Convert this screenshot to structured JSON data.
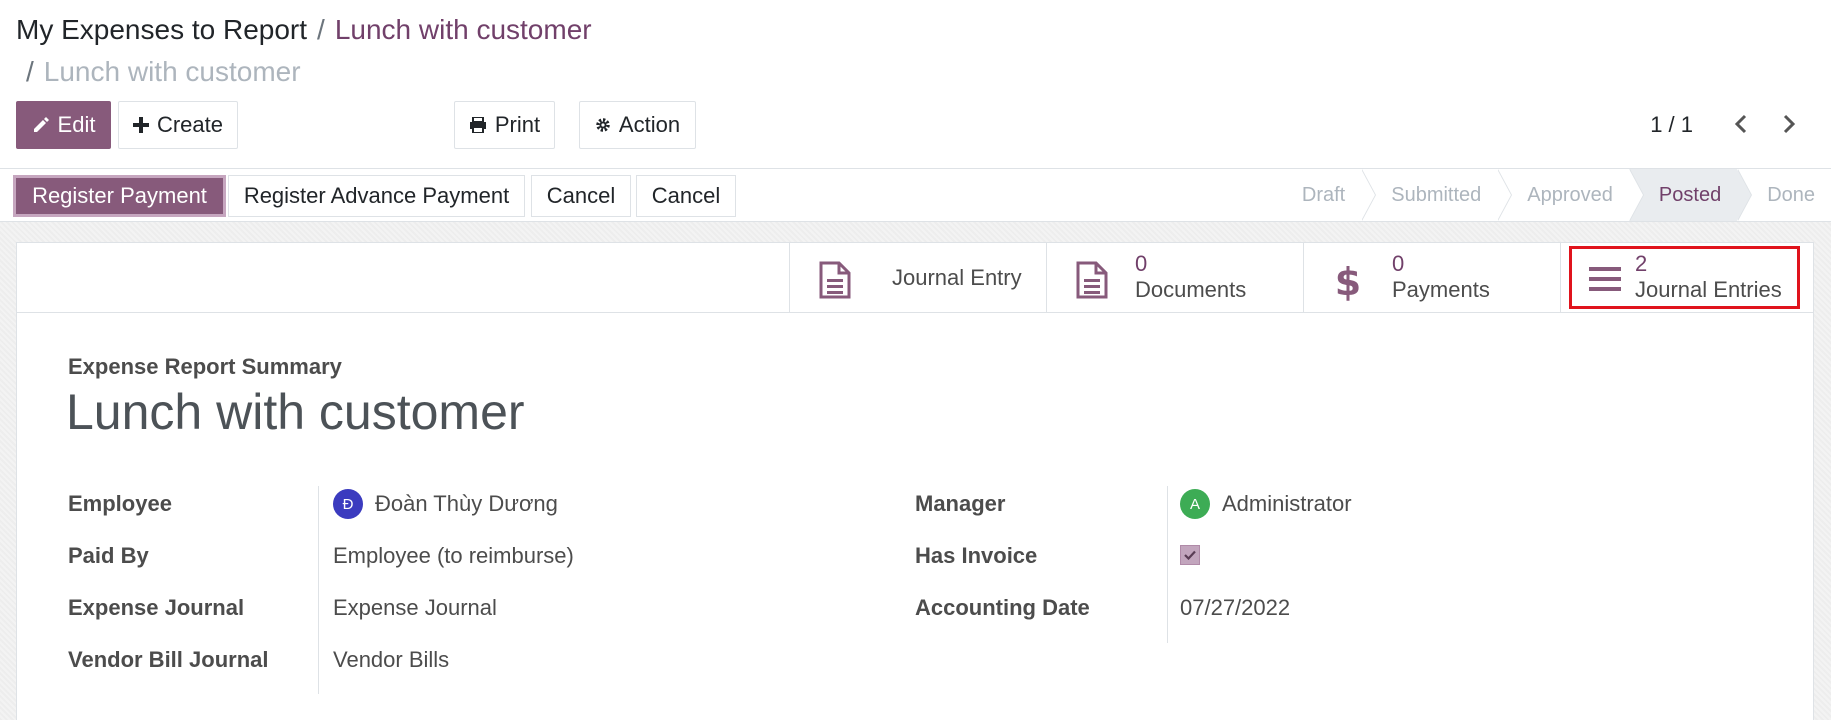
{
  "breadcrumb": {
    "root": "My Expenses to Report",
    "separator": "/",
    "parent": "Lunch with customer",
    "current": "Lunch with customer"
  },
  "toolbar": {
    "edit_label": "Edit",
    "create_label": "Create",
    "print_label": "Print",
    "action_label": "Action"
  },
  "pager": {
    "value": "1 / 1"
  },
  "statusbar": {
    "buttons": [
      "Register Payment",
      "Register Advance Payment",
      "Cancel",
      "Cancel"
    ],
    "stages": [
      "Draft",
      "Submitted",
      "Approved",
      "Posted",
      "Done"
    ],
    "current_stage": "Posted"
  },
  "smart_buttons": {
    "journal_entry": {
      "label": "Journal Entry"
    },
    "documents": {
      "count": "0",
      "label": "Documents"
    },
    "payments": {
      "count": "0",
      "label": "Payments"
    },
    "journal_entries": {
      "count": "2",
      "label": "Journal Entries"
    }
  },
  "form": {
    "subtitle": "Expense Report Summary",
    "title": "Lunch with customer",
    "left_fields": [
      {
        "label": "Employee",
        "value": "Đoàn Thùy Dương",
        "avatar": "Đ"
      },
      {
        "label": "Paid By",
        "value": "Employee (to reimburse)"
      },
      {
        "label": "Expense Journal",
        "value": "Expense Journal"
      },
      {
        "label": "Vendor Bill Journal",
        "value": "Vendor Bills"
      }
    ],
    "right_fields": [
      {
        "label": "Manager",
        "value": "Administrator",
        "avatar": "A"
      },
      {
        "label": "Has Invoice",
        "value": "checked"
      },
      {
        "label": "Accounting Date",
        "value": "07/27/2022"
      }
    ]
  },
  "colors": {
    "brand": "#875a7b",
    "link": "#71406a",
    "avatar_employee": "#3b3bbf",
    "avatar_manager": "#3dac55",
    "highlight": "#e0131c"
  },
  "icons": {
    "edit": "pencil-icon",
    "create": "plus-icon",
    "print": "printer-icon",
    "action": "gear-icon",
    "journal_entry": "document-icon",
    "documents": "document-icon",
    "payments": "dollar-icon",
    "journal_entries": "list-icon"
  }
}
